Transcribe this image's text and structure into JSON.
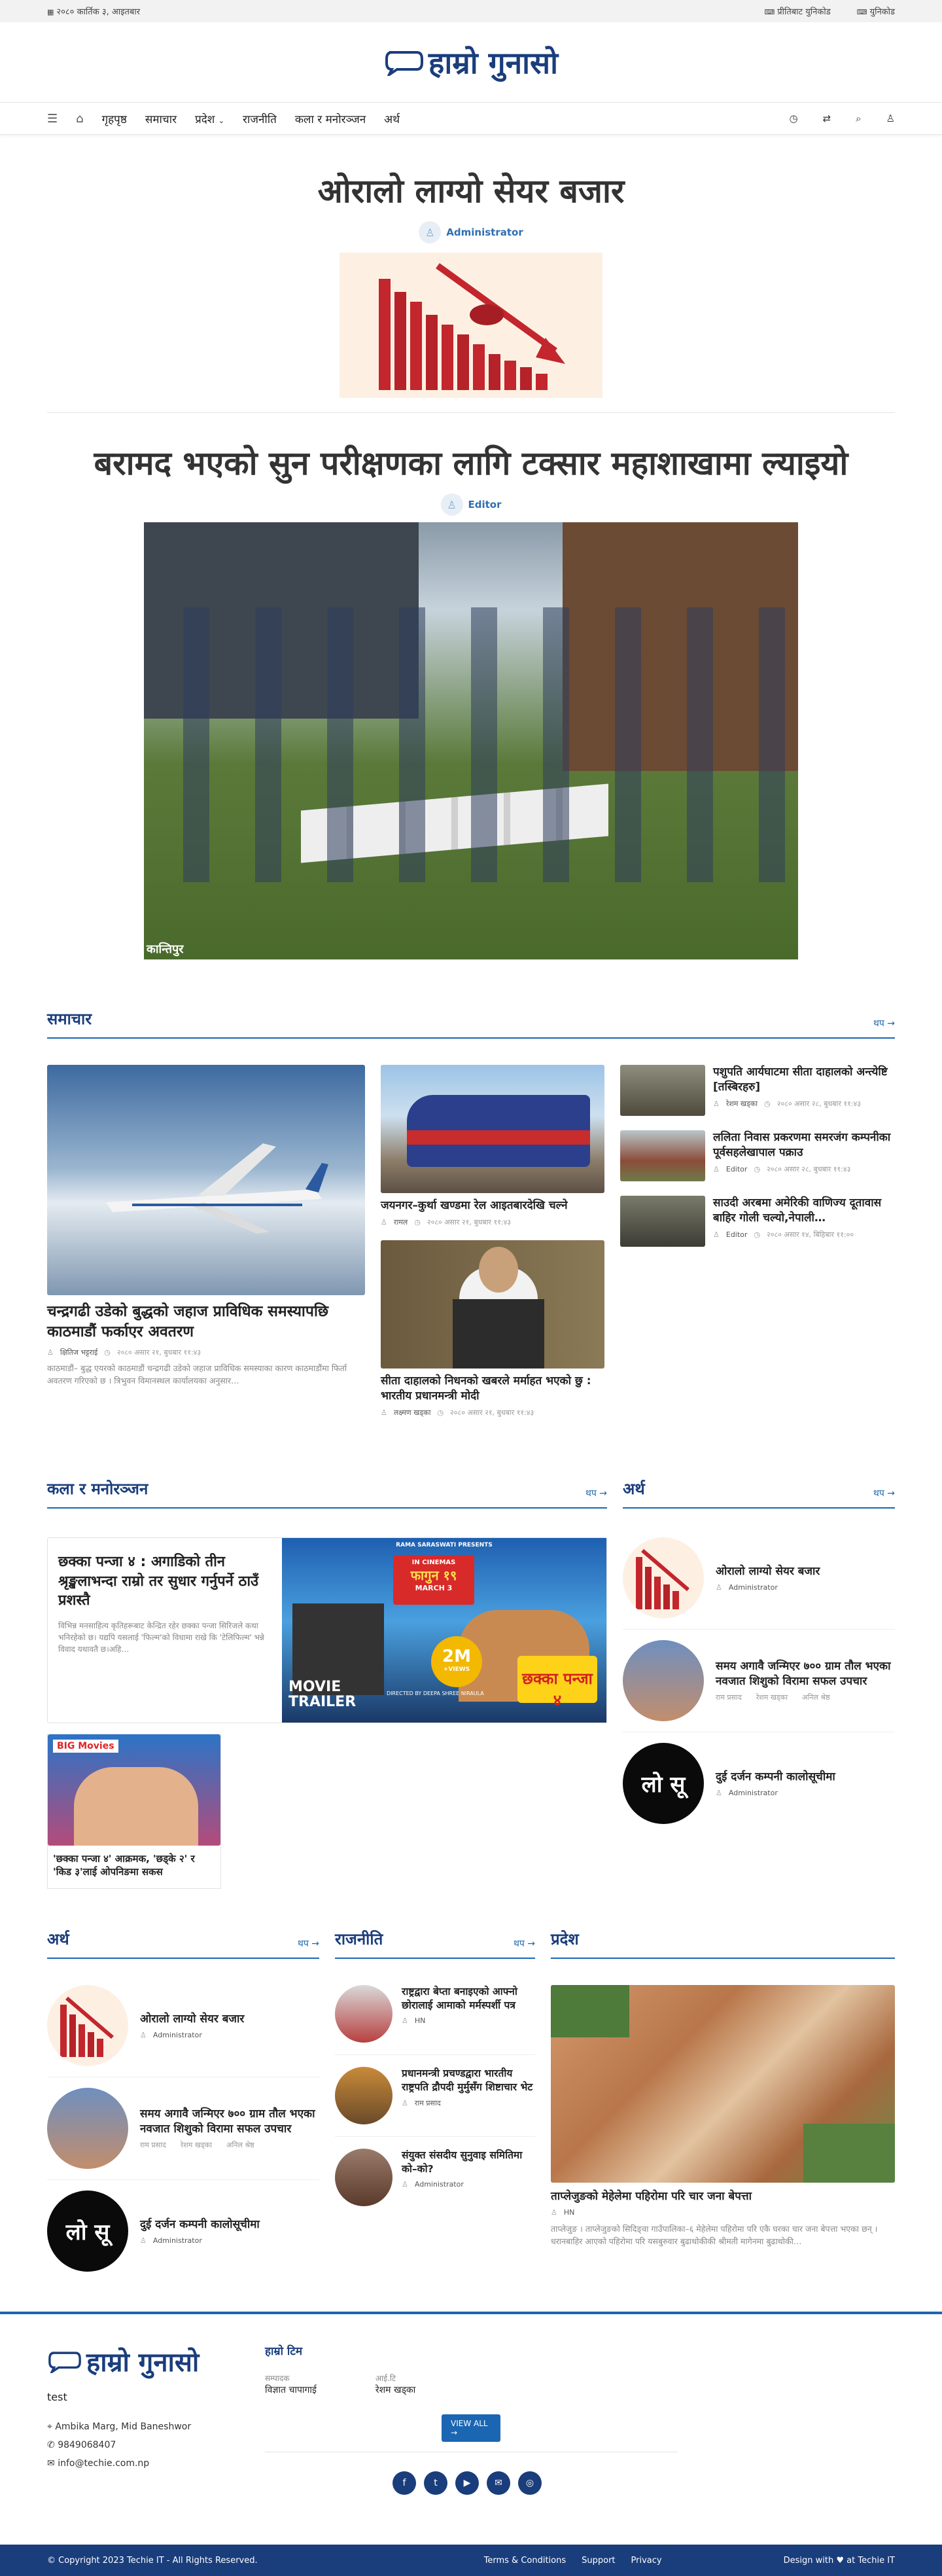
{
  "topbar": {
    "date": "२०८० कार्तिक ३, आइतबार",
    "unicode_conv": "प्रीतिबाट युनिकोड",
    "unicode": "युनिकोड"
  },
  "site": {
    "logo_text": "हाम्रो गुनासो",
    "accent": "#1b66b3",
    "brand": "#1a3d7c"
  },
  "nav": {
    "items": [
      "गृहपृष्ठ",
      "समाचार",
      "प्रदेश",
      "राजनीति",
      "कला र मनोरञ्जन",
      "अर्थ"
    ]
  },
  "hero1": {
    "title": "ओरालो लाग्यो सेयर बजार",
    "author": "Administrator"
  },
  "hero2": {
    "title": "बरामद भएको सुन परीक्षणका लागि टक्सार महाशाखामा ल्याइयो",
    "author": "Editor",
    "watermark": "कान्तिपुर"
  },
  "samachar": {
    "heading": "समाचार",
    "more": "थप →",
    "main": {
      "title": "चन्द्रगढी उडेको बुद्धको जहाज प्राविधिक समस्यापछि काठमाडौं फर्काएर अवतरण",
      "author": "क्षितिज भट्टराई",
      "date": "२०८० असार २१, बुधबार ११:४३",
      "excerpt": "काठमाडौं– बुद्ध एयरको काठमाडौं चन्द्रगढी उडेको जहाज प्राविधिक समस्याका कारण काठमाडौंमा फिर्ता अवतरण गरिएको छ । त्रिभुवन विमानस्थल कार्यालयका अनुसार…"
    },
    "mid": [
      {
        "title": "जयनगर–कुर्था खण्डमा रेल आइतबारदेखि चल्ने",
        "author": "रामल",
        "date": "२०८० असार २१, बुधबार ११:४३"
      },
      {
        "title": "सीता दाहालको निधनको खबरले मर्माहत भएको छु : भारतीय प्रधानमन्त्री मोदी",
        "author": "लक्ष्मण खड्का",
        "date": "२०८० असार २१, बुधबार ११:४३"
      }
    ],
    "side": [
      {
        "title": "पशुपति आर्यघाटमा सीता दाहालको अन्त्येष्टि [तस्बिरहरु]",
        "author": "रेशम खड्का",
        "date": "२०८० असार २८, बुधबार ११:४३"
      },
      {
        "title": "ललिता निवास प्रकरणमा समरजंग कम्पनीका पूर्वसहलेखापाल पक्राउ",
        "author": "Editor",
        "date": "२०८० असार २८, बुधबार ११:४३"
      },
      {
        "title": "साउदी अरबमा अमेरिकी वाणिज्य दूतावास बाहिर गोली चल्यो,नेपाली…",
        "author": "Editor",
        "date": "२०८० असार १४, बिहिबार ११:००"
      }
    ]
  },
  "kala": {
    "heading": "कला र मनोरञ्जन",
    "more": "थप →",
    "main": {
      "title": "छक्का पन्जा ४ : अगाडिको तीन श्रृङ्खलाभन्दा राम्रो तर सुधार गर्नुपर्ने ठाउँ प्रशस्तै",
      "excerpt": "विभिन्न मनसाहित्य कृतिहरूबाट केन्द्रित रहेर छक्का पन्जा सिरिजले कथा भनिरहेको छ। यद्यपि यसलाई 'फिल्म'को विधामा राखे कि 'टेलिफिल्म' भन्ने विवाद यथावतै छ।अहि…"
    },
    "poster": {
      "top": "RAMA SARASWATI PRESENTS",
      "cinemas": "IN CINEMAS",
      "date": "फागुन १९",
      "march": "MARCH 3",
      "movie_title": "छक्का पन्जा ४",
      "badge_num": "2M",
      "badge_sub": "+VIEWS",
      "trailer1": "MOVIE",
      "trailer2": "TRAILER",
      "director": "DIRECTED BY DEEPA SHREE NIRAULA"
    },
    "small": {
      "title": "'छक्का पन्जा ४' आक्रमक, 'छड्के २' र 'किड ३'लाई ओपनिङमा सकस",
      "logo": "BIG Movies"
    }
  },
  "artha_side": {
    "heading": "अर्थ",
    "more": "थप →",
    "items": [
      {
        "title": "ओरालो लाग्यो सेयर बजार",
        "author": "Administrator"
      },
      {
        "title": "समय अगावै जन्मिएर ७०० ग्राम तौल भएका नवजात शिशुको विरामा सफल उपचार",
        "authors": [
          "राम प्रसाद",
          "रेशम खड्का",
          "अनिल श्रेष्ठ"
        ]
      },
      {
        "title": "दुई दर्जन कम्पनी कालोसूचीमा",
        "author": "Administrator",
        "badge": "लो सू"
      }
    ]
  },
  "artha2": {
    "heading": "अर्थ",
    "more": "थप →",
    "items": [
      {
        "title": "ओरालो लाग्यो सेयर बजार",
        "author": "Administrator"
      },
      {
        "title": "समय अगावै जन्मिएर ७०० ग्राम तौल भएका नवजात शिशुको विरामा सफल उपचार",
        "authors": [
          "राम प्रसाद",
          "रेशम खड्का",
          "अनिल श्रेष्ठ"
        ]
      },
      {
        "title": "दुई दर्जन कम्पनी कालोसूचीमा",
        "author": "Administrator",
        "badge": "लो सू"
      }
    ]
  },
  "rajniti": {
    "heading": "राजनीति",
    "more": "थप →",
    "items": [
      {
        "title": "राष्ट्रद्वारा बेप्ता बनाइएको आफ्नो छोरालाई आमाको मर्मस्पर्शी पत्र",
        "author": "HN"
      },
      {
        "title": "प्रधानमन्त्री प्रचण्डद्वारा भारतीय राष्ट्रपति द्रौपदी मुर्मुसँग शिष्टाचार भेट",
        "author": "राम प्रसाद"
      },
      {
        "title": "संयुक्त संसदीय सुनुवाइ समितिमा को–को?",
        "author": "Administrator"
      }
    ]
  },
  "pradesh": {
    "heading": "प्रदेश",
    "main": {
      "title": "ताप्लेजुङको मेहेलेमा पहिरोमा परि चार जना बेपत्ता",
      "author": "HN",
      "excerpt": "ताप्लेजुङ । ताप्लेजुङको सिदिङ्वा गाउँपालिका–६ मेहेलेमा पहिरोमा परि एकै घरका चार जना बेपत्ता भएका छन् । धरानबाहिर आएको पहिरोमा परि यसबुरुवार बुढाथोकीकी श्रीमती मागेनमा बुढाथोकी…"
    }
  },
  "footer": {
    "tagline": "test",
    "address": "Ambika Marg, Mid Baneshwor",
    "phone": "9849068407",
    "email": "info@techie.com.np",
    "team_heading": "हाम्रो टिम",
    "team": [
      {
        "role": "सम्पादक",
        "name": "विज्ञात चापागाई"
      },
      {
        "role": "आई.टि",
        "name": "रेशम खड्का"
      }
    ],
    "view_all": "VIEW ALL →",
    "copyright": "© Copyright 2023 Techie IT - All Rights Reserved.",
    "links": [
      "Terms & Conditions",
      "Support",
      "Privacy"
    ],
    "credit": "Design with ♥ at Techie IT"
  }
}
